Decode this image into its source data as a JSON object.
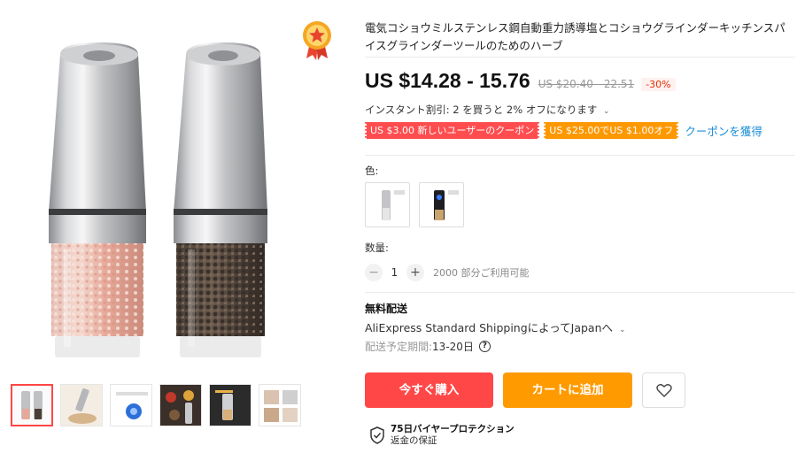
{
  "product": {
    "title": "電気コショウミルステンレス鋼自動重力誘導塩とコショウグラインダーキッチンスパイスグラインダーツールのためのハーブ"
  },
  "gallery": {
    "main_image": "salt-and-pepper-grinders-photo",
    "badge_icon": "award-ribbon-icon",
    "thumbnails": [
      {
        "name": "thumb-grinders-pair",
        "selected": true
      },
      {
        "name": "thumb-grinding-food",
        "selected": false
      },
      {
        "name": "thumb-blue-light",
        "selected": false
      },
      {
        "name": "thumb-spices",
        "selected": false
      },
      {
        "name": "thumb-grinder-in-hand",
        "selected": false
      },
      {
        "name": "thumb-usage-steps",
        "selected": false
      }
    ]
  },
  "price": {
    "current": "US $14.28 - 15.76",
    "original": "US $20.40 - 22.51",
    "discount": "-30%"
  },
  "promo": {
    "instant_discount": "インスタント割引: 2 を買うと 2% オフになります",
    "chevron_icon": "chevron-down-icon",
    "coupons": [
      {
        "label": "US $3.00 新しいユーザーのクーポン",
        "color": "#ff4d4f"
      },
      {
        "label": "US $25.00でUS $1.00オフ",
        "color": "#fe9800"
      }
    ],
    "coupon_link": "クーポンを獲得"
  },
  "variants": {
    "label": "色:",
    "options": [
      {
        "name": "silver-grinder",
        "selected": false
      },
      {
        "name": "blue-light-grinder",
        "selected": false
      }
    ]
  },
  "quantity": {
    "label": "数量:",
    "minus": "−",
    "value": "1",
    "plus": "+",
    "stock": "2000 部分ご利用可能"
  },
  "shipping": {
    "title": "無料配送",
    "method": "AliExpress Standard ShippingによってJapanへ",
    "eta_label": "配送予定期間: ",
    "eta_value": "13-20日",
    "help_icon": "?"
  },
  "actions": {
    "buy_now": "今すぐ購入",
    "add_to_cart": "カートに追加",
    "wishlist_icon": "heart-icon"
  },
  "protection": {
    "title": "75日バイヤープロテクション",
    "subtitle": "返金の保証"
  },
  "colors": {
    "accent_red": "#ff4747",
    "accent_orange": "#ff9a00",
    "link_blue": "#1a8dd6"
  }
}
